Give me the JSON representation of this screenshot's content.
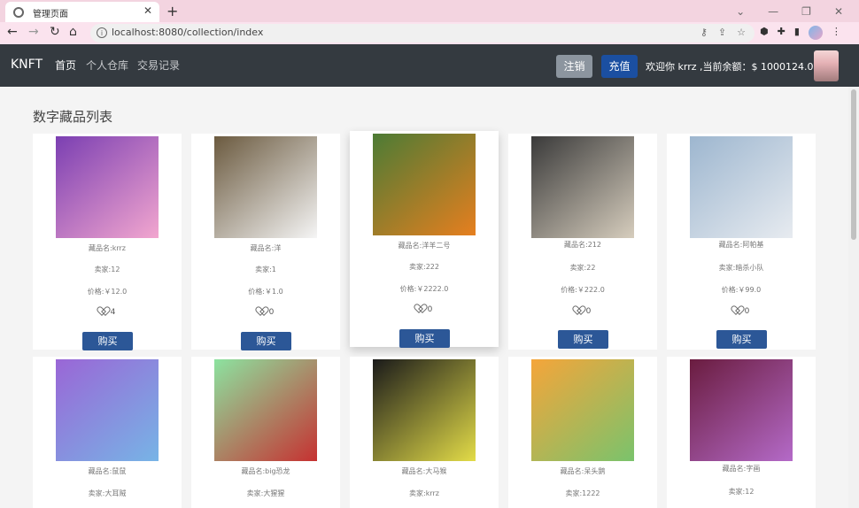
{
  "browser": {
    "tab_title": "管理页面",
    "url": "localhost:8080/collection/index"
  },
  "nav": {
    "brand": "KNFT",
    "links": [
      "首页",
      "个人仓库",
      "交易记录"
    ],
    "logout": "注销",
    "recharge": "充值",
    "welcome": "欢迎你 krrz ,当前余额：$ 1000124.0"
  },
  "page": {
    "title": "数字藏品列表"
  },
  "cards": [
    {
      "name": "藏品名:krrz",
      "seller": "卖家:12",
      "price": "价格:￥12.0",
      "likes": "4",
      "buy": "购买",
      "colors": [
        "#7b3fb2",
        "#f2a6cf"
      ]
    },
    {
      "name": "藏品名:洋",
      "seller": "卖家:1",
      "price": "价格:￥1.0",
      "likes": "0",
      "buy": "购买",
      "colors": [
        "#6b5a3f",
        "#f5f5f5"
      ]
    },
    {
      "name": "藏品名:洋羊二号",
      "seller": "卖家:222",
      "price": "价格:￥2222.0",
      "likes": "0",
      "buy": "购买",
      "colors": [
        "#4c7b35",
        "#e67f1f"
      ]
    },
    {
      "name": "藏品名:212",
      "seller": "卖家:22",
      "price": "价格:￥222.0",
      "likes": "0",
      "buy": "购买",
      "colors": [
        "#3a3a3a",
        "#d6cdbd"
      ]
    },
    {
      "name": "藏品名:阿帕基",
      "seller": "卖家:暗杀小队",
      "price": "价格:￥99.0",
      "likes": "0",
      "buy": "购买",
      "colors": [
        "#9db6cf",
        "#e7ebf0"
      ]
    },
    {
      "name": "藏品名:鼠鼠",
      "seller": "卖家:大耳贼",
      "price": "",
      "likes": "",
      "buy": "",
      "colors": [
        "#9a66d6",
        "#77b4e6"
      ]
    },
    {
      "name": "藏品名:big恐龙",
      "seller": "卖家:大猩猩",
      "price": "",
      "likes": "",
      "buy": "",
      "colors": [
        "#8ce3a0",
        "#c63131"
      ]
    },
    {
      "name": "藏品名:大马猴",
      "seller": "卖家:krrz",
      "price": "",
      "likes": "",
      "buy": "",
      "colors": [
        "#1a1a1a",
        "#e3dc48"
      ]
    },
    {
      "name": "藏品名:呆头鹅",
      "seller": "卖家:1222",
      "price": "",
      "likes": "",
      "buy": "",
      "colors": [
        "#f5a53a",
        "#7ac36c"
      ]
    },
    {
      "name": "藏品名:字画",
      "seller": "卖家:12",
      "price": "",
      "likes": "",
      "buy": "",
      "colors": [
        "#6a1c3f",
        "#b46ac8"
      ]
    }
  ]
}
